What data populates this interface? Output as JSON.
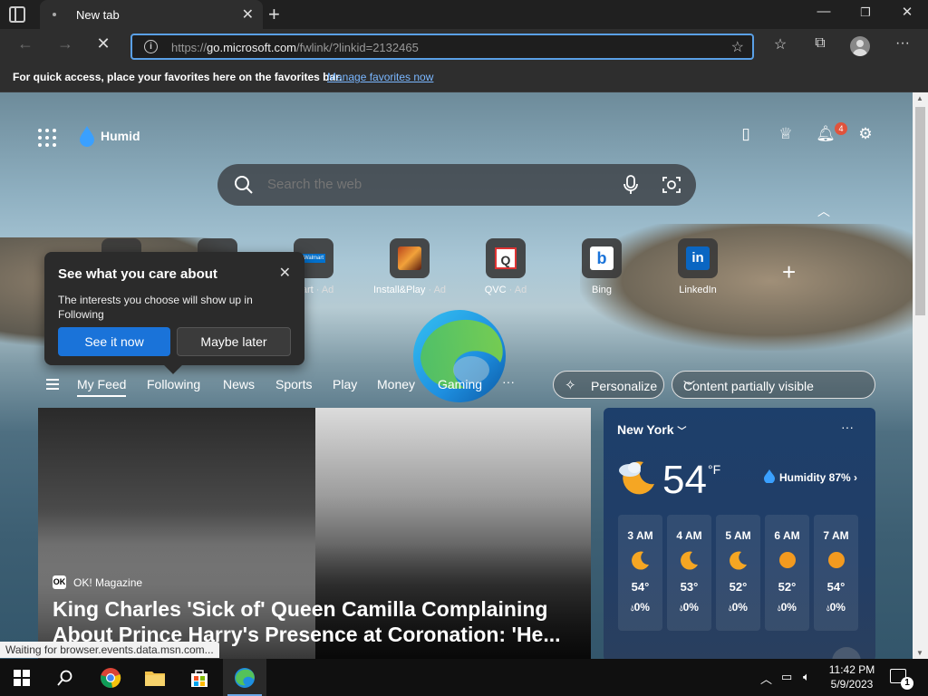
{
  "tab": {
    "title": "New tab"
  },
  "address": {
    "url_prefix": "https://",
    "url_host": "go.microsoft.com",
    "url_path": "/fwlink/?linkid=2132465"
  },
  "favorites_bar": {
    "text": "For quick access, place your favorites here on the favorites bar.",
    "link": "Manage favorites now"
  },
  "header": {
    "weather_label": "Humid",
    "notification_count": "4"
  },
  "search": {
    "placeholder": "Search the web"
  },
  "quick_links": [
    {
      "label": "",
      "ad": ""
    },
    {
      "label": "",
      "ad": ""
    },
    {
      "label": "mart",
      "ad": "· Ad",
      "icon": "walmart-icon",
      "icon_text": "Walmart"
    },
    {
      "label": "Install&Play",
      "ad": "· Ad",
      "icon": "game-icon"
    },
    {
      "label": "QVC",
      "ad": "· Ad",
      "icon": "qvc-icon",
      "icon_text": "Q"
    },
    {
      "label": "Bing",
      "ad": "",
      "icon": "bing-icon",
      "icon_text": "b"
    },
    {
      "label": "LinkedIn",
      "ad": "",
      "icon": "linkedin-icon",
      "icon_text": "in"
    }
  ],
  "popup": {
    "title": "See what you care about",
    "body": "The interests you choose will show up in Following",
    "primary": "See it now",
    "secondary": "Maybe later"
  },
  "feed_nav": {
    "tabs": [
      "My Feed",
      "Following",
      "News",
      "Sports",
      "Play",
      "Money",
      "Gaming"
    ],
    "more": "···",
    "personalize": "Personalize",
    "content_visibility": "Content partially visible"
  },
  "hero": {
    "source_icon": "OK",
    "source": "OK! Magazine",
    "title": "King Charles 'Sick of' Queen Camilla Complaining About Prince Harry's Presence at Coronation: 'He..."
  },
  "weather": {
    "city": "New York",
    "temp": "54",
    "unit": "°F",
    "humidity": "Humidity 87%",
    "hours": [
      {
        "time": "3 AM",
        "icon": "moon-icon",
        "temp": "54°",
        "precip": "0%"
      },
      {
        "time": "4 AM",
        "icon": "moon-icon",
        "temp": "53°",
        "precip": "0%"
      },
      {
        "time": "5 AM",
        "icon": "moon-icon",
        "temp": "52°",
        "precip": "0%"
      },
      {
        "time": "6 AM",
        "icon": "sun-icon",
        "temp": "52°",
        "precip": "0%"
      },
      {
        "time": "7 AM",
        "icon": "sun-icon",
        "temp": "54°",
        "precip": "0%"
      }
    ]
  },
  "status_bar": {
    "text": "Waiting for browser.events.data.msn.com..."
  },
  "taskbar": {
    "time": "11:42 PM",
    "date": "5/9/2023",
    "notifications": "1"
  },
  "colors": {
    "accent": "#1a73d9",
    "address_focus": "#5aa0e6",
    "badge": "#e0533c"
  }
}
